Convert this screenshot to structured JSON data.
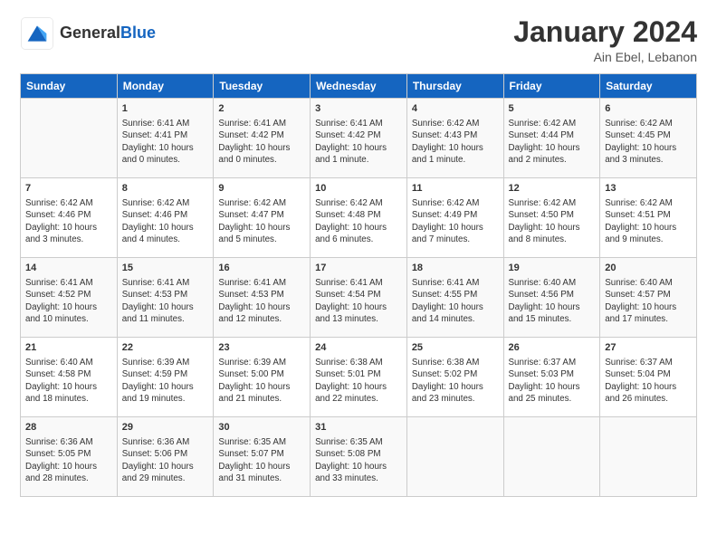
{
  "header": {
    "logo_general": "General",
    "logo_blue": "Blue",
    "month_title": "January 2024",
    "location": "Ain Ebel, Lebanon"
  },
  "days_of_week": [
    "Sunday",
    "Monday",
    "Tuesday",
    "Wednesday",
    "Thursday",
    "Friday",
    "Saturday"
  ],
  "weeks": [
    [
      {
        "day": "",
        "content": ""
      },
      {
        "day": "1",
        "content": "Sunrise: 6:41 AM\nSunset: 4:41 PM\nDaylight: 10 hours\nand 0 minutes."
      },
      {
        "day": "2",
        "content": "Sunrise: 6:41 AM\nSunset: 4:42 PM\nDaylight: 10 hours\nand 0 minutes."
      },
      {
        "day": "3",
        "content": "Sunrise: 6:41 AM\nSunset: 4:42 PM\nDaylight: 10 hours\nand 1 minute."
      },
      {
        "day": "4",
        "content": "Sunrise: 6:42 AM\nSunset: 4:43 PM\nDaylight: 10 hours\nand 1 minute."
      },
      {
        "day": "5",
        "content": "Sunrise: 6:42 AM\nSunset: 4:44 PM\nDaylight: 10 hours\nand 2 minutes."
      },
      {
        "day": "6",
        "content": "Sunrise: 6:42 AM\nSunset: 4:45 PM\nDaylight: 10 hours\nand 3 minutes."
      }
    ],
    [
      {
        "day": "7",
        "content": "Sunrise: 6:42 AM\nSunset: 4:46 PM\nDaylight: 10 hours\nand 3 minutes."
      },
      {
        "day": "8",
        "content": "Sunrise: 6:42 AM\nSunset: 4:46 PM\nDaylight: 10 hours\nand 4 minutes."
      },
      {
        "day": "9",
        "content": "Sunrise: 6:42 AM\nSunset: 4:47 PM\nDaylight: 10 hours\nand 5 minutes."
      },
      {
        "day": "10",
        "content": "Sunrise: 6:42 AM\nSunset: 4:48 PM\nDaylight: 10 hours\nand 6 minutes."
      },
      {
        "day": "11",
        "content": "Sunrise: 6:42 AM\nSunset: 4:49 PM\nDaylight: 10 hours\nand 7 minutes."
      },
      {
        "day": "12",
        "content": "Sunrise: 6:42 AM\nSunset: 4:50 PM\nDaylight: 10 hours\nand 8 minutes."
      },
      {
        "day": "13",
        "content": "Sunrise: 6:42 AM\nSunset: 4:51 PM\nDaylight: 10 hours\nand 9 minutes."
      }
    ],
    [
      {
        "day": "14",
        "content": "Sunrise: 6:41 AM\nSunset: 4:52 PM\nDaylight: 10 hours\nand 10 minutes."
      },
      {
        "day": "15",
        "content": "Sunrise: 6:41 AM\nSunset: 4:53 PM\nDaylight: 10 hours\nand 11 minutes."
      },
      {
        "day": "16",
        "content": "Sunrise: 6:41 AM\nSunset: 4:53 PM\nDaylight: 10 hours\nand 12 minutes."
      },
      {
        "day": "17",
        "content": "Sunrise: 6:41 AM\nSunset: 4:54 PM\nDaylight: 10 hours\nand 13 minutes."
      },
      {
        "day": "18",
        "content": "Sunrise: 6:41 AM\nSunset: 4:55 PM\nDaylight: 10 hours\nand 14 minutes."
      },
      {
        "day": "19",
        "content": "Sunrise: 6:40 AM\nSunset: 4:56 PM\nDaylight: 10 hours\nand 15 minutes."
      },
      {
        "day": "20",
        "content": "Sunrise: 6:40 AM\nSunset: 4:57 PM\nDaylight: 10 hours\nand 17 minutes."
      }
    ],
    [
      {
        "day": "21",
        "content": "Sunrise: 6:40 AM\nSunset: 4:58 PM\nDaylight: 10 hours\nand 18 minutes."
      },
      {
        "day": "22",
        "content": "Sunrise: 6:39 AM\nSunset: 4:59 PM\nDaylight: 10 hours\nand 19 minutes."
      },
      {
        "day": "23",
        "content": "Sunrise: 6:39 AM\nSunset: 5:00 PM\nDaylight: 10 hours\nand 21 minutes."
      },
      {
        "day": "24",
        "content": "Sunrise: 6:38 AM\nSunset: 5:01 PM\nDaylight: 10 hours\nand 22 minutes."
      },
      {
        "day": "25",
        "content": "Sunrise: 6:38 AM\nSunset: 5:02 PM\nDaylight: 10 hours\nand 23 minutes."
      },
      {
        "day": "26",
        "content": "Sunrise: 6:37 AM\nSunset: 5:03 PM\nDaylight: 10 hours\nand 25 minutes."
      },
      {
        "day": "27",
        "content": "Sunrise: 6:37 AM\nSunset: 5:04 PM\nDaylight: 10 hours\nand 26 minutes."
      }
    ],
    [
      {
        "day": "28",
        "content": "Sunrise: 6:36 AM\nSunset: 5:05 PM\nDaylight: 10 hours\nand 28 minutes."
      },
      {
        "day": "29",
        "content": "Sunrise: 6:36 AM\nSunset: 5:06 PM\nDaylight: 10 hours\nand 29 minutes."
      },
      {
        "day": "30",
        "content": "Sunrise: 6:35 AM\nSunset: 5:07 PM\nDaylight: 10 hours\nand 31 minutes."
      },
      {
        "day": "31",
        "content": "Sunrise: 6:35 AM\nSunset: 5:08 PM\nDaylight: 10 hours\nand 33 minutes."
      },
      {
        "day": "",
        "content": ""
      },
      {
        "day": "",
        "content": ""
      },
      {
        "day": "",
        "content": ""
      }
    ]
  ]
}
